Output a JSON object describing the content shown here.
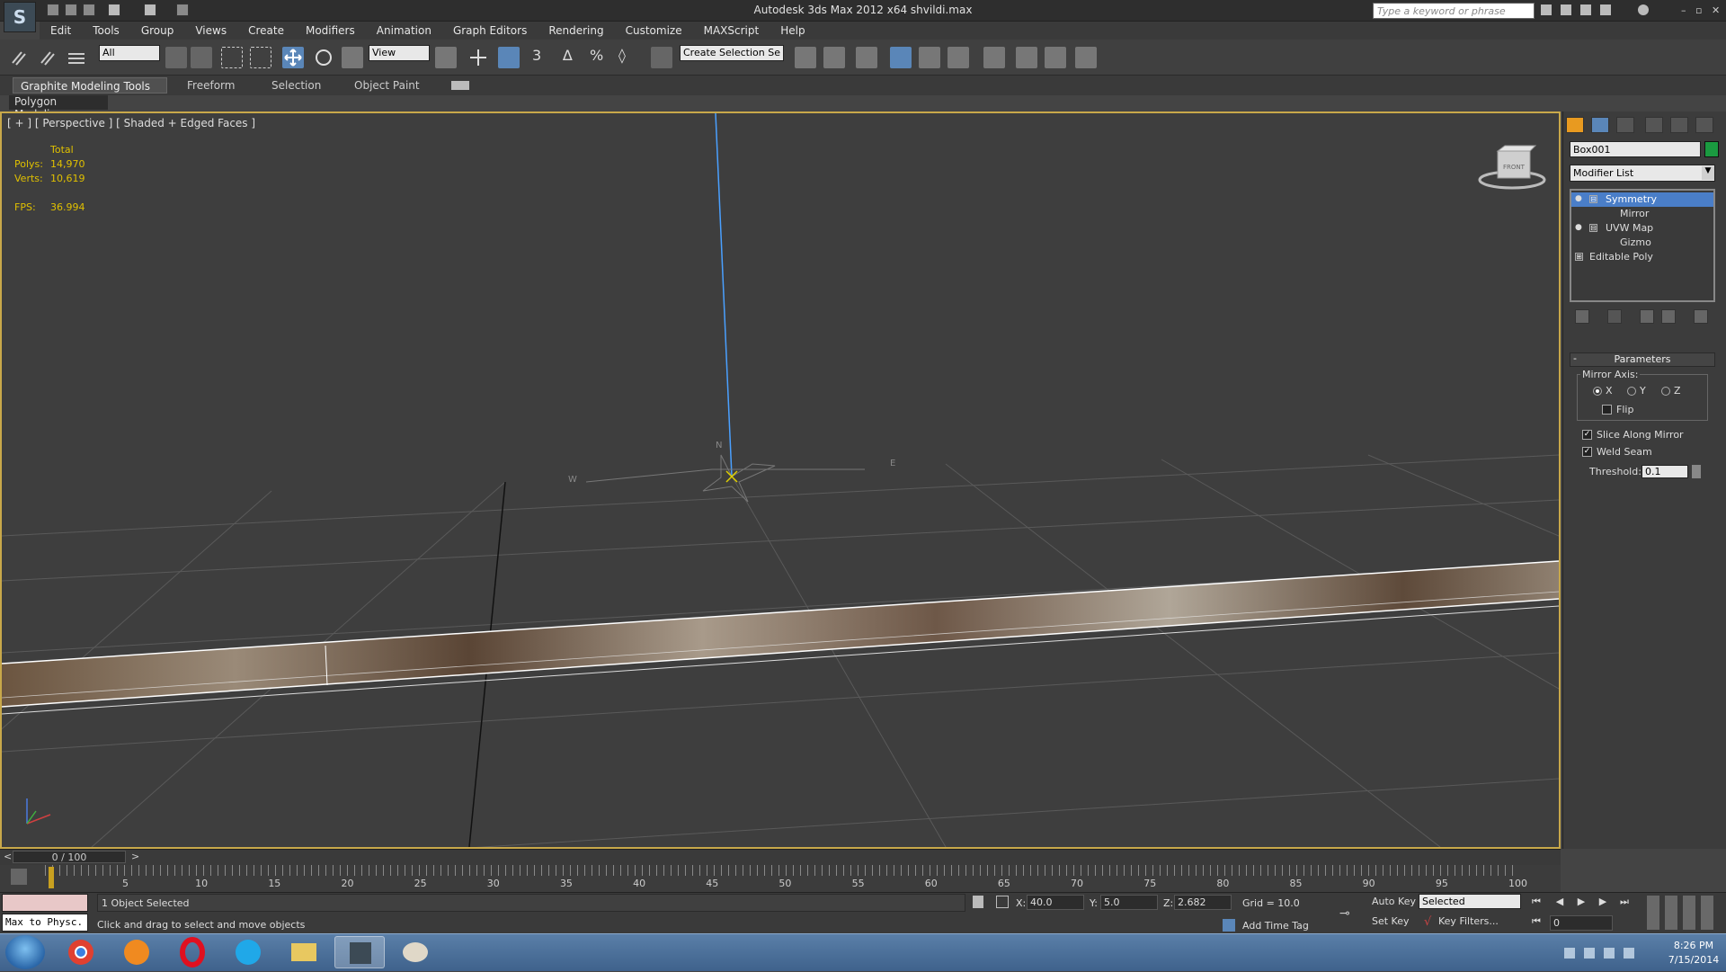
{
  "titlebar": {
    "title": "Autodesk 3ds Max  2012 x64     shvildi.max",
    "search_placeholder": "Type a keyword or phrase",
    "min": "–",
    "max": "▫",
    "close": "✕"
  },
  "menu": [
    "Edit",
    "Tools",
    "Group",
    "Views",
    "Create",
    "Modifiers",
    "Animation",
    "Graph Editors",
    "Rendering",
    "Customize",
    "MAXScript",
    "Help"
  ],
  "toolbar": {
    "selection_filter": "All",
    "ref_coord": "View",
    "named_selection": "Create Selection Se",
    "snap_3": "3",
    "snap_angle": "∆",
    "snap_pct": "%",
    "spinner_snap": "◊"
  },
  "ribbon": {
    "tabs": [
      "Graphite Modeling Tools",
      "Freeform",
      "Selection",
      "Object Paint"
    ],
    "active_tab": 0,
    "panel": "Polygon Modeling"
  },
  "viewport": {
    "label": "[ + ] [ Perspective ] [ Shaded + Edged Faces ]",
    "stats": {
      "total_label": "Total",
      "polys_label": "Polys:",
      "polys": "14,970",
      "verts_label": "Verts:",
      "verts": "10,619",
      "fps_label": "FPS:",
      "fps": "36.994"
    },
    "viewcube_label": "FRONT",
    "compass": {
      "n": "N",
      "w": "W",
      "e": "E"
    }
  },
  "command_panel": {
    "object_name": "Box001",
    "object_color": "#1a9a40",
    "modifier_list": "Modifier List",
    "stack": [
      {
        "label": "Symmetry",
        "selected": true,
        "expand": "⊟"
      },
      {
        "label": "Mirror",
        "sub": true
      },
      {
        "label": "UVW Map",
        "expand": "⊟"
      },
      {
        "label": "Gizmo",
        "sub": true
      },
      {
        "label": "Editable Poly",
        "expand": "⊞"
      }
    ],
    "parameters": {
      "title": "Parameters",
      "collapse": "-",
      "mirror_axis_label": "Mirror Axis:",
      "axes": [
        "X",
        "Y",
        "Z"
      ],
      "selected_axis": "X",
      "flip_label": "Flip",
      "flip": false,
      "slice_label": "Slice Along Mirror",
      "slice": true,
      "weld_label": "Weld Seam",
      "weld": true,
      "threshold_label": "Threshold:",
      "threshold": "0.1"
    }
  },
  "timeline": {
    "slider": "0 / 100",
    "prev": "<",
    "next": ">",
    "ticks": [
      "5",
      "10",
      "15",
      "20",
      "25",
      "30",
      "35",
      "40",
      "45",
      "50",
      "55",
      "60",
      "65",
      "70",
      "75",
      "80",
      "85",
      "90",
      "95",
      "100"
    ]
  },
  "status": {
    "maxscript": "Max to Physc.",
    "selection": "1 Object Selected",
    "prompt": "Click and drag to select and move objects",
    "x_label": "X:",
    "x": "40.0",
    "y_label": "Y:",
    "y": "5.0",
    "z_label": "Z:",
    "z": "2.682",
    "grid": "Grid = 10.0",
    "auto_key": "Auto Key",
    "selected": "Selected",
    "set_key": "Set Key",
    "key_filters": "Key Filters...",
    "add_time_tag": "Add Time Tag",
    "frame": "0"
  },
  "taskbar": {
    "time": "8:26 PM",
    "date": "7/15/2014"
  }
}
